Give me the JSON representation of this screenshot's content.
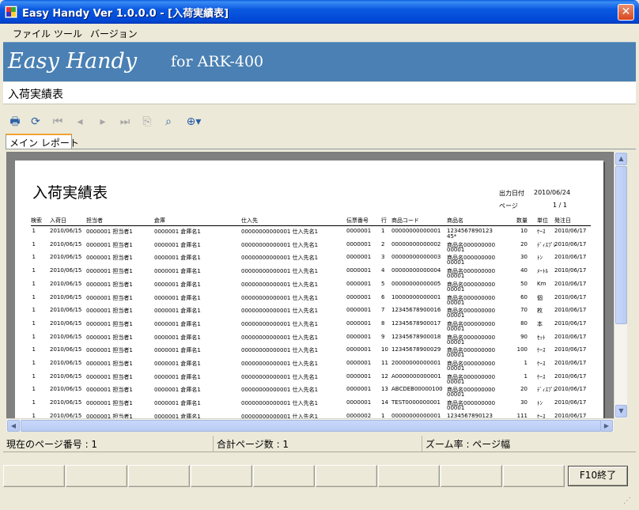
{
  "window": {
    "title": "Easy Handy  Ver 1.0.0.0 - [入荷実績表]",
    "close_glyph": "✕"
  },
  "menu": [
    "ファイル",
    "ツール",
    "バージョン"
  ],
  "banner": {
    "title": "Easy Handy",
    "subtitle": "for ARK-400"
  },
  "screen_title": "入荷実績表",
  "toolbar": [
    {
      "icon": "print-icon",
      "glyph": "🖶"
    },
    {
      "icon": "refresh-icon",
      "glyph": "⟳"
    },
    {
      "icon": "first-page-icon",
      "glyph": "⏮"
    },
    {
      "icon": "prev-page-icon",
      "glyph": "◂"
    },
    {
      "icon": "next-page-icon",
      "glyph": "▸"
    },
    {
      "icon": "last-page-icon",
      "glyph": "⏭"
    },
    {
      "icon": "export-icon",
      "glyph": "⎘"
    },
    {
      "icon": "find-icon",
      "glyph": "⌕"
    },
    {
      "icon": "zoom-icon",
      "glyph": "⊕▾"
    }
  ],
  "tab": "メイン レポート",
  "report": {
    "title": "入荷実績表",
    "output_date_label": "出力日付",
    "output_date": "2010/06/24",
    "page_label": "ページ",
    "page_value": "1 /  1",
    "headers": [
      "検索",
      "入荷日",
      "担当者",
      "倉庫",
      "仕入先",
      "伝票番号",
      "行",
      "商品コード",
      "商品名",
      "数量",
      "単位",
      "発注日"
    ],
    "rows": [
      [
        "1",
        "2010/06/15",
        "0000001 担当者1",
        "0000001 倉庫名1",
        "00000000000001 仕入先名1",
        "0000001",
        "1",
        "00000000000001",
        "1234567890123",
        "10",
        "ｹｰｽ",
        "2010/06/17"
      ],
      [
        "1",
        "2010/06/15",
        "0000001 担当者1",
        "0000001 倉庫名1",
        "00000000000001 仕入先名1",
        "0000001",
        "2",
        "00000000000002",
        "商品名000000000",
        "20",
        "ﾃﾞｨｽﾌﾟﾚ",
        "2010/06/17"
      ],
      [
        "1",
        "2010/06/15",
        "0000001 担当者1",
        "0000001 倉庫名1",
        "00000000000001 仕入先名1",
        "0000001",
        "3",
        "00000000000003",
        "商品名000000000",
        "30",
        "ﾄﾝ",
        "2010/06/17"
      ],
      [
        "1",
        "2010/06/15",
        "0000001 担当者1",
        "0000001 倉庫名1",
        "00000000000001 仕入先名1",
        "0000001",
        "4",
        "00000000000004",
        "商品名000000000",
        "40",
        "ﾒｰﾄﾙ",
        "2010/06/17"
      ],
      [
        "1",
        "2010/06/15",
        "0000001 担当者1",
        "0000001 倉庫名1",
        "00000000000001 仕入先名1",
        "0000001",
        "5",
        "00000000000005",
        "商品名000000000",
        "50",
        "Km",
        "2010/06/17"
      ],
      [
        "1",
        "2010/06/15",
        "0000001 担当者1",
        "0000001 倉庫名1",
        "00000000000001 仕入先名1",
        "0000001",
        "6",
        "10000000000001",
        "商品名000000000",
        "60",
        "個",
        "2010/06/17"
      ],
      [
        "1",
        "2010/06/15",
        "0000001 担当者1",
        "0000001 倉庫名1",
        "00000000000001 仕入先名1",
        "0000001",
        "7",
        "12345678900016",
        "商品名000000000",
        "70",
        "枚",
        "2010/06/17"
      ],
      [
        "1",
        "2010/06/15",
        "0000001 担当者1",
        "0000001 倉庫名1",
        "00000000000001 仕入先名1",
        "0000001",
        "8",
        "12345678900017",
        "商品名000000000",
        "80",
        "本",
        "2010/06/17"
      ],
      [
        "1",
        "2010/06/15",
        "0000001 担当者1",
        "0000001 倉庫名1",
        "00000000000001 仕入先名1",
        "0000001",
        "9",
        "12345678900018",
        "商品名000000000",
        "90",
        "ｾｯﾄ",
        "2010/06/17"
      ],
      [
        "1",
        "2010/06/15",
        "0000001 担当者1",
        "0000001 倉庫名1",
        "00000000000001 仕入先名1",
        "0000001",
        "10",
        "12345678900029",
        "商品名000000000",
        "100",
        "ｹｰｽ",
        "2010/06/17"
      ],
      [
        "1",
        "2010/06/15",
        "0000001 担当者1",
        "0000001 倉庫名1",
        "00000000000001 仕入先名1",
        "0000001",
        "11",
        "20000000000001",
        "商品名000000000",
        "1",
        "ｹｰｽ",
        "2010/06/17"
      ],
      [
        "1",
        "2010/06/15",
        "0000001 担当者1",
        "0000001 倉庫名1",
        "00000000000001 仕入先名1",
        "0000001",
        "12",
        "A0000000000001",
        "商品名000000000",
        "1",
        "ｹｰｽ",
        "2010/06/17"
      ],
      [
        "1",
        "2010/06/15",
        "0000001 担当者1",
        "0000001 倉庫名1",
        "00000000000001 仕入先名1",
        "0000001",
        "13",
        "ABCDEB00000100",
        "商品名000000000",
        "20",
        "ﾃﾞｨｽﾌﾟﾚ",
        "2010/06/17"
      ],
      [
        "1",
        "2010/06/15",
        "0000001 担当者1",
        "0000001 倉庫名1",
        "00000000000001 仕入先名1",
        "0000001",
        "14",
        "TEST0000000001",
        "商品名000000000",
        "30",
        "ﾄﾝ",
        "2010/06/17"
      ],
      [
        "1",
        "2010/06/15",
        "0000001 担当者1",
        "0000001 倉庫名1",
        "00000000000001 仕入先名1",
        "0000002",
        "1",
        "00000000000001",
        "1234567890123",
        "111",
        "ｹｰｽ",
        "2010/06/17"
      ]
    ],
    "wrap_lines": [
      "45*",
      "00001",
      "00001",
      "00001",
      "00001",
      "00001",
      "00001",
      "00001",
      "00001",
      "00001",
      "00001",
      "00001",
      "00001",
      "00001",
      ""
    ]
  },
  "status": {
    "current_page": "現在のページ番号 : 1",
    "total_pages": "合計ページ数 : 1",
    "zoom": "ズーム率 : ページ幅"
  },
  "fkeys": [
    "",
    "",
    "",
    "",
    "",
    "",
    "",
    "",
    "",
    "F10終了"
  ]
}
